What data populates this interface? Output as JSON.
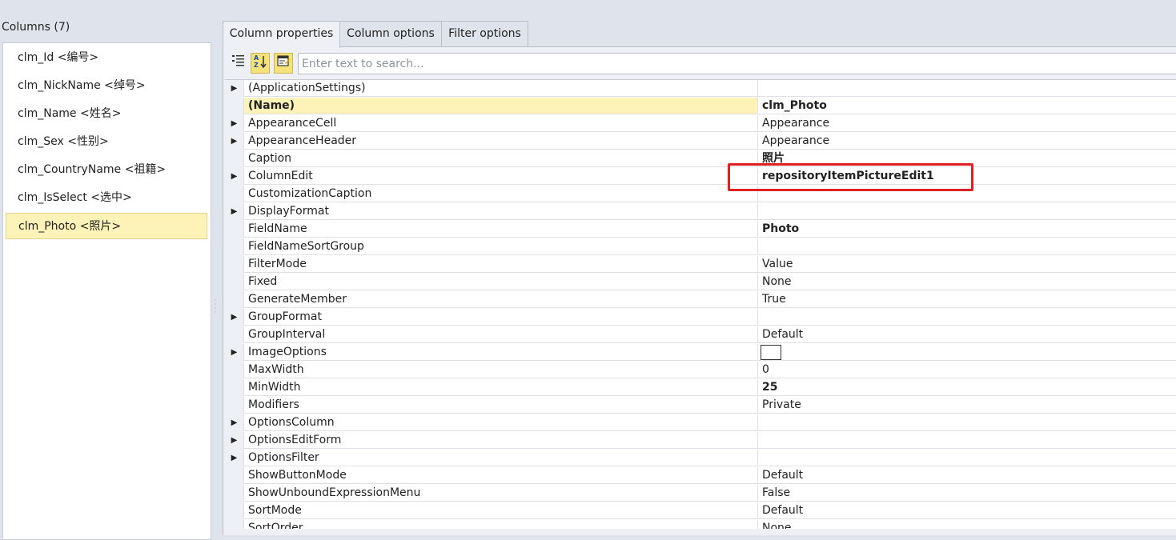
{
  "columns": {
    "header": "Columns (7)",
    "items": [
      {
        "label": "clm_Id <编号>",
        "selected": false
      },
      {
        "label": "clm_NickName <绰号>",
        "selected": false
      },
      {
        "label": "clm_Name <姓名>",
        "selected": false
      },
      {
        "label": "clm_Sex <性别>",
        "selected": false
      },
      {
        "label": "clm_CountryName <祖籍>",
        "selected": false
      },
      {
        "label": "clm_IsSelect <选中>",
        "selected": false
      },
      {
        "label": "clm_Photo <照片>",
        "selected": true
      }
    ]
  },
  "tabs": [
    {
      "label": "Column properties",
      "active": true
    },
    {
      "label": "Column options",
      "active": false
    },
    {
      "label": "Filter options",
      "active": false
    }
  ],
  "toolbar": {
    "categorized_icon": "categorized-icon",
    "alphabetical_icon": "alphabetical-sort-icon",
    "property_pages_icon": "property-pages-icon",
    "search_placeholder": "Enter text to search..."
  },
  "properties": [
    {
      "name": "(ApplicationSettings)",
      "value": "",
      "expandable": true
    },
    {
      "name": "(Name)",
      "value": "clm_Photo",
      "bold": true,
      "selected": true
    },
    {
      "name": "AppearanceCell",
      "value": "Appearance",
      "expandable": true
    },
    {
      "name": "AppearanceHeader",
      "value": "Appearance",
      "expandable": true
    },
    {
      "name": "Caption",
      "value": "照片",
      "bold": true
    },
    {
      "name": "ColumnEdit",
      "value": "repositoryItemPictureEdit1",
      "bold": true,
      "expandable": true,
      "highlighted": true
    },
    {
      "name": "CustomizationCaption",
      "value": ""
    },
    {
      "name": "DisplayFormat",
      "value": "",
      "expandable": true
    },
    {
      "name": "FieldName",
      "value": "Photo",
      "bold": true
    },
    {
      "name": "FieldNameSortGroup",
      "value": ""
    },
    {
      "name": "FilterMode",
      "value": "Value"
    },
    {
      "name": "Fixed",
      "value": "None"
    },
    {
      "name": "GenerateMember",
      "value": "True"
    },
    {
      "name": "GroupFormat",
      "value": "",
      "expandable": true
    },
    {
      "name": "GroupInterval",
      "value": "Default"
    },
    {
      "name": "ImageOptions",
      "value": "",
      "expandable": true,
      "color_box": true
    },
    {
      "name": "MaxWidth",
      "value": "0"
    },
    {
      "name": "MinWidth",
      "value": "25",
      "bold": true
    },
    {
      "name": "Modifiers",
      "value": "Private"
    },
    {
      "name": "OptionsColumn",
      "value": "",
      "expandable": true
    },
    {
      "name": "OptionsEditForm",
      "value": "",
      "expandable": true
    },
    {
      "name": "OptionsFilter",
      "value": "",
      "expandable": true
    },
    {
      "name": "ShowButtonMode",
      "value": "Default"
    },
    {
      "name": "ShowUnboundExpressionMenu",
      "value": "False"
    },
    {
      "name": "SortMode",
      "value": "Default"
    },
    {
      "name": "SortOrder",
      "value": "None"
    }
  ],
  "colors": {
    "selection": "#fdf2b8",
    "highlight_box": "#e02020",
    "panel_bg": "#dfe3ec"
  }
}
